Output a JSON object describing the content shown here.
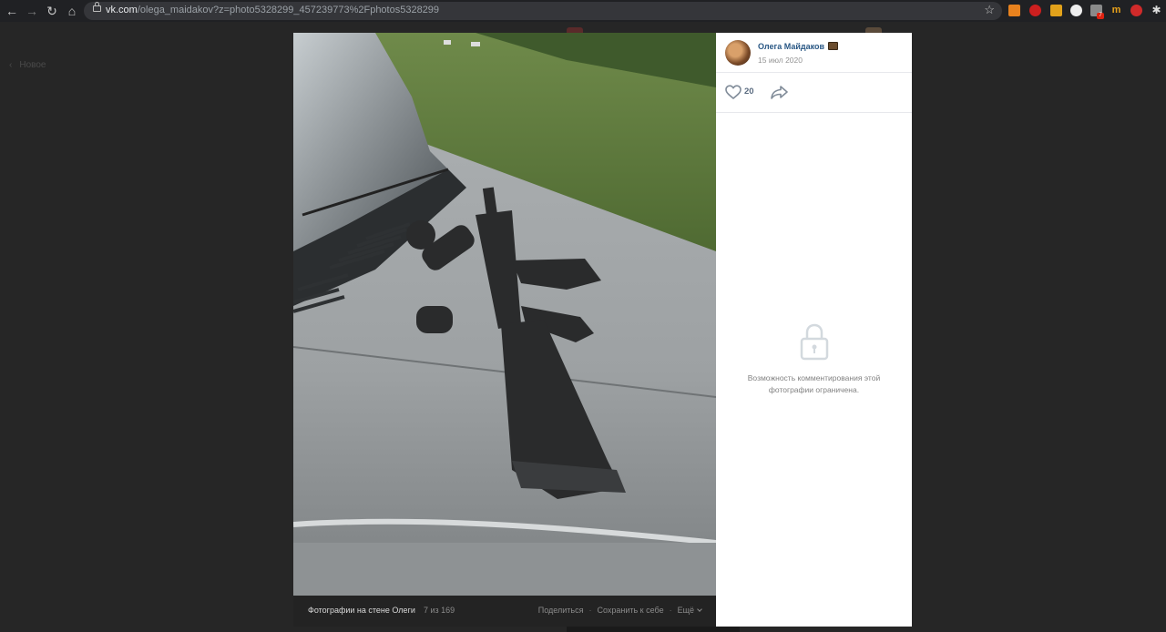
{
  "browser": {
    "url_host": "vk.com",
    "url_path": "/olega_maidakov?z=photo5328299_457239773%2Fphotos5328299",
    "extensions": [
      "rss-icon",
      "extension-red-icon",
      "bookmark-icon",
      "extension-circle-icon",
      "extension-gray-icon",
      "m-icon",
      "opera-icon",
      "puzzle-icon"
    ],
    "extension_badge": "7"
  },
  "page": {
    "back_label": "Новое"
  },
  "post": {
    "author_name": "Олега Майдаков",
    "date": "15 июл 2020",
    "likes": "20",
    "comments_restricted": "Возможность комментирования этой фотографии ограничена."
  },
  "photo_bar": {
    "album": "Фотографии на стене Олеги",
    "counter": "7 из 169",
    "share": "Поделиться",
    "save": "Сохранить к себе",
    "more": "Ещё"
  },
  "colors": {
    "link": "#2a5885",
    "overlay": "#262626",
    "panel": "#ffffff"
  }
}
